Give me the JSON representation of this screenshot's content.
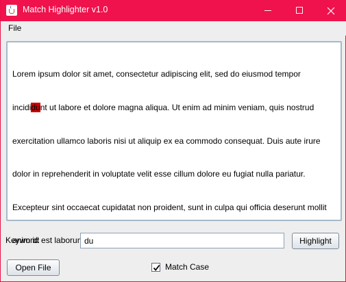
{
  "window": {
    "title": "Match Highlighter v1.0",
    "accent_color": "#f0124c",
    "icon": "java-cup-icon"
  },
  "menu": {
    "items": [
      {
        "label": "File"
      }
    ]
  },
  "text_area": {
    "lines": [
      "Lorem ipsum dolor sit amet, consectetur adipiscing elit, sed do eiusmod tempor",
      [
        "incidi",
        "du",
        "nt ut labore et dolore magna aliqua. Ut enim ad minim veniam, quis nostrud"
      ],
      "exercitation ullamco laboris nisi ut aliquip ex ea commodo consequat. Duis aute irure",
      "dolor in reprehenderit in voluptate velit esse cillum dolore eu fugiat nulla pariatur.",
      "Excepteur sint occaecat cupidatat non proident, sunt in culpa qui officia deserunt mollit",
      "anim id est laborum."
    ],
    "highlight_color": "#cc0000"
  },
  "keyword": {
    "label": "Keyword:",
    "value": "du"
  },
  "buttons": {
    "highlight": "Highlight",
    "open_file": "Open File"
  },
  "match_case": {
    "label": "Match Case",
    "checked": true
  }
}
